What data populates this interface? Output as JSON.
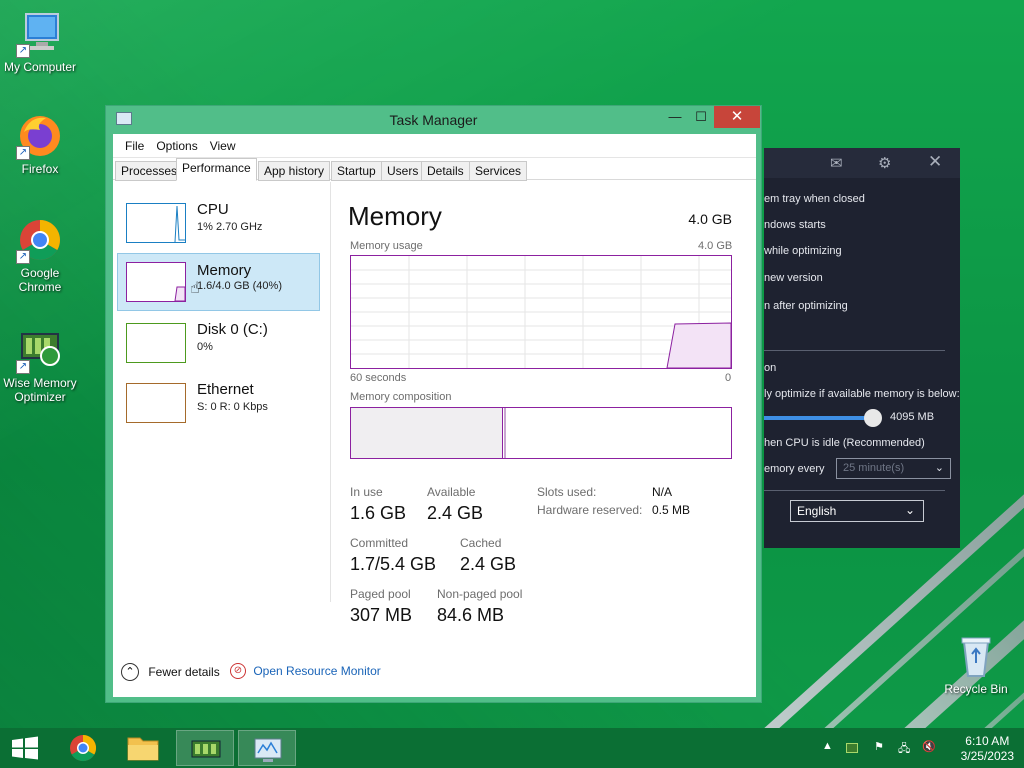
{
  "desktop": {
    "icons": [
      {
        "label": "My Computer"
      },
      {
        "label": "Firefox"
      },
      {
        "label": "Google Chrome"
      },
      {
        "label": "Wise Memory Optimizer"
      },
      {
        "label": "Recycle Bin"
      }
    ]
  },
  "task_manager": {
    "title": "Task Manager",
    "menu": [
      "File",
      "Options",
      "View"
    ],
    "tabs": [
      "Processes",
      "Performance",
      "App history",
      "Startup",
      "Users",
      "Details",
      "Services"
    ],
    "active_tab": "Performance",
    "sidebar": [
      {
        "name": "CPU",
        "sub": "1% 2.70 GHz"
      },
      {
        "name": "Memory",
        "sub": "1.6/4.0 GB (40%)"
      },
      {
        "name": "Disk 0 (C:)",
        "sub": "0%"
      },
      {
        "name": "Ethernet",
        "sub": "S: 0 R: 0 Kbps"
      }
    ],
    "main": {
      "title": "Memory",
      "capacity": "4.0 GB",
      "usage_label": "Memory usage",
      "usage_max": "4.0 GB",
      "time_left": "60 seconds",
      "time_right": "0",
      "composition_label": "Memory composition",
      "stats": {
        "in_use_label": "In use",
        "in_use": "1.6 GB",
        "available_label": "Available",
        "available": "2.4 GB",
        "committed_label": "Committed",
        "committed": "1.7/5.4 GB",
        "cached_label": "Cached",
        "cached": "2.4 GB",
        "paged_label": "Paged pool",
        "paged": "307 MB",
        "nonpaged_label": "Non-paged pool",
        "nonpaged": "84.6 MB",
        "slots_label": "Slots used:",
        "slots": "N/A",
        "hwres_label": "Hardware reserved:",
        "hwres": "0.5 MB"
      }
    },
    "footer": {
      "fewer_details": "Fewer details",
      "resource_monitor": "Open Resource Monitor"
    }
  },
  "wise_panel": {
    "rows": [
      "em tray when closed",
      "ndows starts",
      "while optimizing",
      "new version",
      "n after optimizing",
      "on",
      "ly optimize if available memory is below:",
      "4095 MB",
      "hen CPU is idle (Recommended)",
      "emory every"
    ],
    "interval": "25 minute(s)",
    "language": "English"
  },
  "taskbar": {
    "time": "6:10 AM",
    "date": "3/25/2023"
  },
  "colors": {
    "memory_accent": "#8c21a0",
    "cpu_accent": "#1a7fc3",
    "disk_accent": "#4d9a1e",
    "ethernet_accent": "#a56a2b",
    "selection": "#cde8f7"
  }
}
